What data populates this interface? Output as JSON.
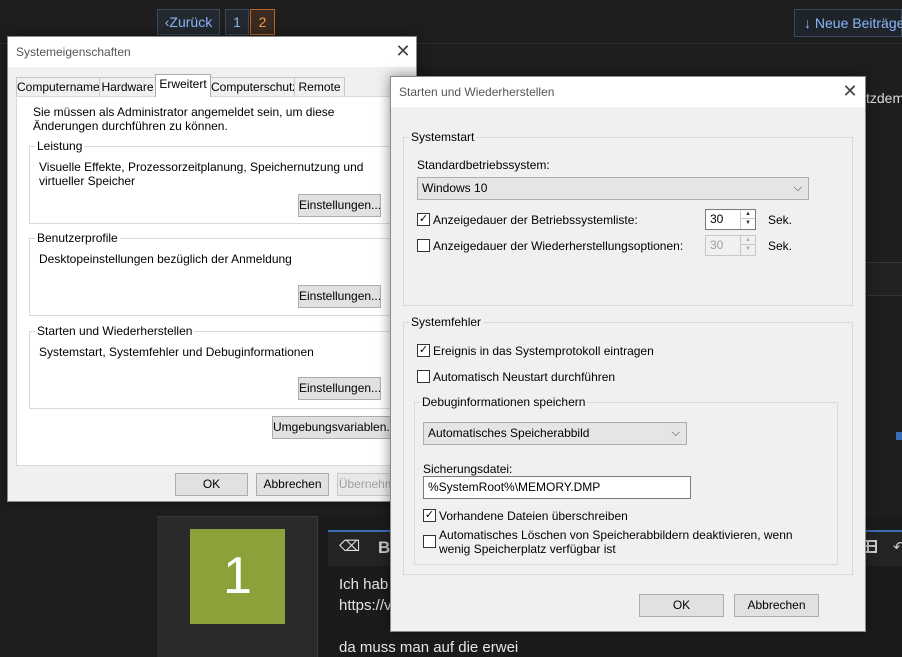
{
  "forum": {
    "prev_label": "‹Zurück",
    "page_1": "1",
    "page_2": "2",
    "new_posts_label": "↓ Neue Beiträge",
    "bg_text_right": "tzdem",
    "avatar_initial": "1",
    "post_lines": [
      "Ich hab",
      "https://v",
      "da muss man auf die erwei"
    ],
    "toolbar": {
      "bold_label": "B"
    }
  },
  "sys_props": {
    "title": "Systemeigenschaften",
    "close_glyph": "✕",
    "tabs": [
      {
        "label": "Computername"
      },
      {
        "label": "Hardware"
      },
      {
        "label": "Erweitert"
      },
      {
        "label": "Computerschutz"
      },
      {
        "label": "Remote"
      }
    ],
    "admin_note": "Sie müssen als Administrator angemeldet sein, um diese Änderungen durchführen zu können.",
    "groups": [
      {
        "title": "Leistung",
        "desc": "Visuelle Effekte, Prozessorzeitplanung, Speichernutzung und virtueller Speicher",
        "button": "Einstellungen..."
      },
      {
        "title": "Benutzerprofile",
        "desc": "Desktopeinstellungen bezüglich der Anmeldung",
        "button": "Einstellungen..."
      },
      {
        "title": "Starten und Wiederherstellen",
        "desc": "Systemstart, Systemfehler und Debuginformationen",
        "button": "Einstellungen..."
      }
    ],
    "env_button": "Umgebungsvariablen...",
    "ok": "OK",
    "cancel": "Abbrechen",
    "apply": "Übernehmen"
  },
  "startup": {
    "title": "Starten und Wiederherstellen",
    "close_glyph": "✕",
    "systemstart": {
      "group_title": "Systemstart",
      "default_os_label": "Standardbetriebssystem:",
      "default_os_value": "Windows 10",
      "show_list_label": "Anzeigedauer der Betriebssystemliste:",
      "show_list_checked": true,
      "show_list_value": "30",
      "show_recovery_label": "Anzeigedauer der Wiederherstellungsoptionen:",
      "show_recovery_checked": false,
      "show_recovery_value": "30",
      "unit": "Sek."
    },
    "systemfehler": {
      "group_title": "Systemfehler",
      "log_event_label": "Ereignis in das Systemprotokoll eintragen",
      "log_event_checked": true,
      "auto_restart_label": "Automatisch Neustart durchführen",
      "auto_restart_checked": false,
      "debug_group_title": "Debuginformationen speichern",
      "debug_type_value": "Automatisches Speicherabbild",
      "dump_file_label": "Sicherungsdatei:",
      "dump_file_value": "%SystemRoot%\\MEMORY.DMP",
      "overwrite_label": "Vorhandene Dateien überschreiben",
      "overwrite_checked": true,
      "disable_autodelete_label": "Automatisches Löschen von Speicherabbildern deaktivieren, wenn wenig Speicherplatz verfügbar ist",
      "disable_autodelete_checked": false
    },
    "ok": "OK",
    "cancel": "Abbrechen"
  },
  "icons": {
    "check": "✓",
    "combo_arrow": "⌵",
    "spin_up": "▲",
    "spin_down": "▼",
    "eraser": "⌫",
    "undo": "↶"
  }
}
